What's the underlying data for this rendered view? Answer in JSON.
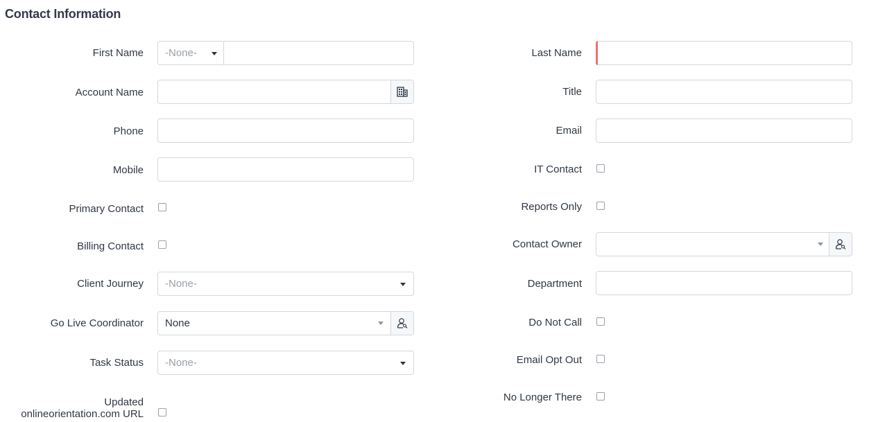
{
  "section": {
    "title": "Contact Information"
  },
  "left": {
    "first_name": {
      "label": "First Name",
      "salutation_value": "-None-",
      "value": ""
    },
    "account_name": {
      "label": "Account Name",
      "value": "",
      "icon": "building-icon"
    },
    "phone": {
      "label": "Phone",
      "value": ""
    },
    "mobile": {
      "label": "Mobile",
      "value": ""
    },
    "primary_contact": {
      "label": "Primary Contact",
      "checked": false
    },
    "billing_contact": {
      "label": "Billing Contact",
      "checked": false
    },
    "client_journey": {
      "label": "Client Journey",
      "value": "-None-"
    },
    "go_live_coordinator": {
      "label": "Go Live Coordinator",
      "value": "None",
      "icon": "user-lookup-icon"
    },
    "task_status": {
      "label": "Task Status",
      "value": "-None-"
    },
    "updated_url": {
      "label_line1": "Updated",
      "label_line2": "onlineorientation.com URL",
      "checked": false
    }
  },
  "right": {
    "last_name": {
      "label": "Last Name",
      "value": "",
      "required": true
    },
    "title": {
      "label": "Title",
      "value": ""
    },
    "email": {
      "label": "Email",
      "value": ""
    },
    "it_contact": {
      "label": "IT Contact",
      "checked": false
    },
    "reports_only": {
      "label": "Reports Only",
      "checked": false
    },
    "contact_owner": {
      "label": "Contact Owner",
      "value": "",
      "icon": "user-lookup-icon"
    },
    "department": {
      "label": "Department",
      "value": ""
    },
    "do_not_call": {
      "label": "Do Not Call",
      "checked": false
    },
    "email_opt_out": {
      "label": "Email Opt Out",
      "checked": false
    },
    "no_longer_there": {
      "label": "No Longer There",
      "checked": false
    }
  },
  "colors": {
    "required": "#e8746d",
    "border": "#d3d7dd",
    "text": "#2f3744"
  }
}
